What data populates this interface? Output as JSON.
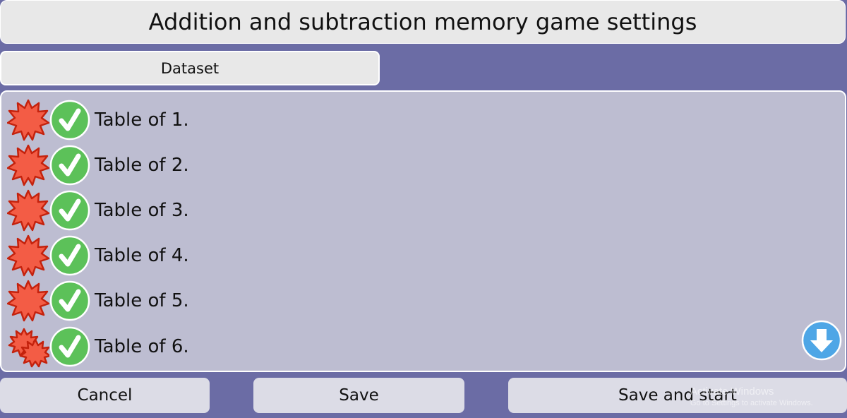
{
  "header": {
    "title": "Addition and subtraction memory game settings"
  },
  "tabs": [
    {
      "label": "Dataset"
    }
  ],
  "colors": {
    "background": "#6b6ca5",
    "panel": "#bdbdd1",
    "check_green": "#5cc159",
    "burst_red": "#f35c45",
    "scroll_blue": "#4ea6e6"
  },
  "dataset": {
    "items": [
      {
        "label": "Table of 1.",
        "icon": "difficulty-burst-icon",
        "checked": true
      },
      {
        "label": "Table of 2.",
        "icon": "difficulty-burst-icon",
        "checked": true
      },
      {
        "label": "Table of 3.",
        "icon": "difficulty-burst-icon",
        "checked": true
      },
      {
        "label": "Table of 4.",
        "icon": "difficulty-burst-icon",
        "checked": true
      },
      {
        "label": "Table of 5.",
        "icon": "difficulty-burst-icon",
        "checked": true
      },
      {
        "label": "Table of 6.",
        "icon": "difficulty-double-burst-icon",
        "checked": true
      }
    ]
  },
  "footer": {
    "cancel_label": "Cancel",
    "save_label": "Save",
    "save_start_label": "Save and start"
  },
  "watermark": {
    "title": "Activate Windows",
    "subtitle": "Go to Settings to activate Windows."
  }
}
